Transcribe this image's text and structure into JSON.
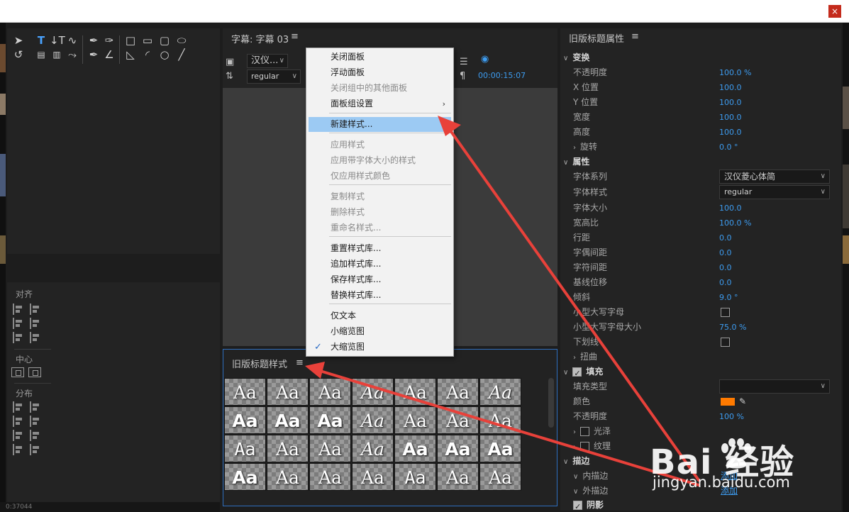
{
  "window": {
    "close_glyph": "×"
  },
  "caption_panel": {
    "title": "字幕: 字幕 03",
    "menu_glyph": "≡",
    "font_family_short": "汉仪...",
    "font_style": "regular",
    "timecode": "00:00:15:07"
  },
  "styles_panel": {
    "title": "旧版标题样式",
    "menu_glyph": "≡",
    "swatch_text": "Aa",
    "swatches": [
      "Aa",
      "Aa",
      "Aa",
      "Aa",
      "Aa",
      "Aa",
      "Aa",
      "Aa",
      "Aa",
      "Aa",
      "Aa",
      "Aa",
      "Aa",
      "Aa",
      "Aa",
      "Aa",
      "Aa",
      "Aa",
      "Aa",
      "Aa",
      "Aa",
      "Aa",
      "Aa",
      "Aa",
      "Aa",
      "Aa",
      "Aa",
      "Aa"
    ]
  },
  "context_menu": {
    "items": [
      {
        "label": "关闭面板",
        "state": "enabled"
      },
      {
        "label": "浮动面板",
        "state": "enabled"
      },
      {
        "label": "关闭组中的其他面板",
        "state": "disabled"
      },
      {
        "label": "面板组设置",
        "state": "submenu"
      },
      {
        "label": "新建样式...",
        "state": "highlighted"
      },
      {
        "label": "应用样式",
        "state": "disabled"
      },
      {
        "label": "应用带字体大小的样式",
        "state": "disabled"
      },
      {
        "label": "仅应用样式颜色",
        "state": "disabled"
      },
      {
        "label": "复制样式",
        "state": "disabled"
      },
      {
        "label": "删除样式",
        "state": "disabled"
      },
      {
        "label": "重命名样式...",
        "state": "disabled"
      },
      {
        "label": "重置样式库...",
        "state": "enabled"
      },
      {
        "label": "追加样式库...",
        "state": "enabled"
      },
      {
        "label": "保存样式库...",
        "state": "enabled"
      },
      {
        "label": "替换样式库...",
        "state": "enabled"
      },
      {
        "label": "仅文本",
        "state": "enabled"
      },
      {
        "label": "小缩览图",
        "state": "enabled"
      },
      {
        "label": "大缩览图",
        "state": "checked"
      }
    ],
    "submenu_arrow": "›",
    "check_glyph": "✓"
  },
  "align_panel": {
    "align_label": "对齐",
    "center_label": "中心",
    "distribute_label": "分布"
  },
  "properties_panel": {
    "title": "旧版标题属性",
    "menu_glyph": "≡",
    "transform": {
      "heading": "变换",
      "rows": [
        {
          "label": "不透明度",
          "value": "100.0 %"
        },
        {
          "label": "X 位置",
          "value": "100.0"
        },
        {
          "label": "Y 位置",
          "value": "100.0"
        },
        {
          "label": "宽度",
          "value": "100.0"
        },
        {
          "label": "高度",
          "value": "100.0"
        },
        {
          "label": "旋转",
          "value": "0.0 °"
        }
      ]
    },
    "attributes": {
      "heading": "属性",
      "font_family_label": "字体系列",
      "font_family_value": "汉仪菱心体简",
      "font_style_label": "字体样式",
      "font_style_value": "regular",
      "rows": [
        {
          "label": "字体大小",
          "value": "100.0"
        },
        {
          "label": "宽高比",
          "value": "100.0 %"
        },
        {
          "label": "行距",
          "value": "0.0"
        },
        {
          "label": "字偶间距",
          "value": "0.0"
        },
        {
          "label": "字符间距",
          "value": "0.0"
        },
        {
          "label": "基线位移",
          "value": "0.0"
        },
        {
          "label": "倾斜",
          "value": "9.0 °"
        }
      ],
      "small_caps_label": "小型大写字母",
      "small_caps_size_label": "小型大写字母大小",
      "small_caps_size_value": "75.0 %",
      "underline_label": "下划线",
      "distort_label": "扭曲"
    },
    "fill": {
      "heading": "填充",
      "fill_type_label": "填充类型",
      "color_label": "颜色",
      "color_hex": "#ff7a00",
      "opacity_label": "不透明度",
      "opacity_value": "100 %",
      "sheen_label": "光泽",
      "texture_label": "纹理"
    },
    "stroke": {
      "heading": "描边",
      "inner_label": "内描边",
      "outer_label": "外描边",
      "add_label": "添加"
    },
    "shadow_heading": "阴影"
  },
  "watermark": {
    "logo_text": "Bai  经验",
    "site_text": "jingyan.baidu.com"
  },
  "bottom": {
    "timecode": "0:37044"
  },
  "colors": {
    "accent_blue": "#3d9cf0",
    "annotation_red": "#e8413a",
    "highlight": "#9ccaf3"
  },
  "icons": [
    "close-icon",
    "selection-tool-icon",
    "rotate-tool-icon",
    "type-tool-icon",
    "vertical-type-tool-icon",
    "area-type-tool-icon",
    "path-type-tool-icon",
    "pen-tool-icon",
    "rectangle-tool-icon",
    "ellipse-tool-icon",
    "line-tool-icon",
    "hamburger-icon",
    "eyedropper-icon",
    "checkmark-icon",
    "chevron-down-icon"
  ]
}
